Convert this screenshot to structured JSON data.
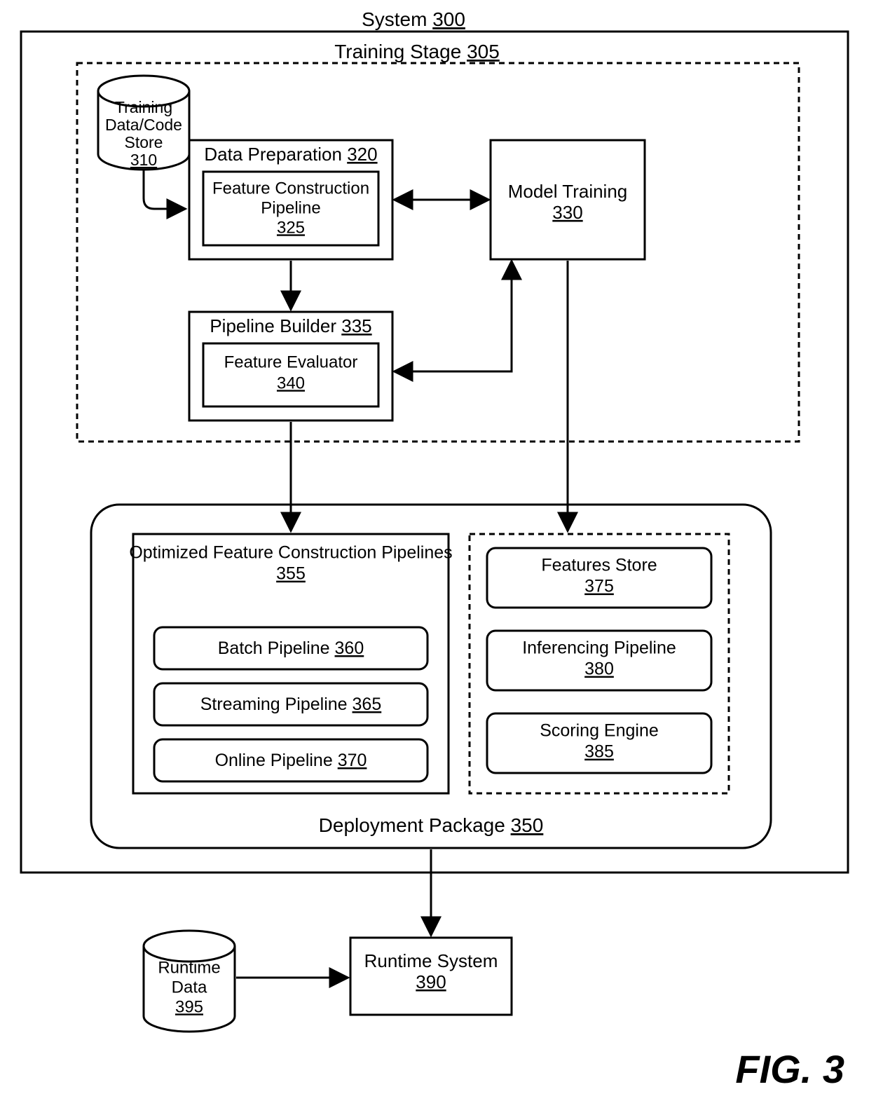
{
  "fig": "FIG. 3",
  "system": {
    "label": "System",
    "ref": "300"
  },
  "trainingStage": {
    "label": "Training Stage",
    "ref": "305"
  },
  "dataStore": {
    "l1": "Training",
    "l2": "Data/Code",
    "l3": "Store",
    "ref": "310"
  },
  "dataPrep": {
    "label": "Data Preparation",
    "ref": "320"
  },
  "featConstr": {
    "l1": "Feature Construction",
    "l2": "Pipeline",
    "ref": "325"
  },
  "modelTrain": {
    "l1": "Model Training",
    "ref": "330"
  },
  "pipeBuilder": {
    "label": "Pipeline Builder",
    "ref": "335"
  },
  "featEval": {
    "l1": "Feature Evaluator",
    "ref": "340"
  },
  "deployPkg": {
    "label": "Deployment Package",
    "ref": "350"
  },
  "optFeat": {
    "l1": "Optimized Feature Construction Pipelines",
    "ref": "355"
  },
  "batch": {
    "label": "Batch Pipeline",
    "ref": "360"
  },
  "stream": {
    "label": "Streaming Pipeline",
    "ref": "365"
  },
  "online": {
    "label": "Online Pipeline",
    "ref": "370"
  },
  "featStore": {
    "l1": "Features Store",
    "ref": "375"
  },
  "infPipe": {
    "l1": "Inferencing Pipeline",
    "ref": "380"
  },
  "scoreEng": {
    "l1": "Scoring Engine",
    "ref": "385"
  },
  "runtimeSys": {
    "l1": "Runtime System",
    "ref": "390"
  },
  "runtimeData": {
    "l1": "Runtime",
    "l2": "Data",
    "ref": "395"
  }
}
